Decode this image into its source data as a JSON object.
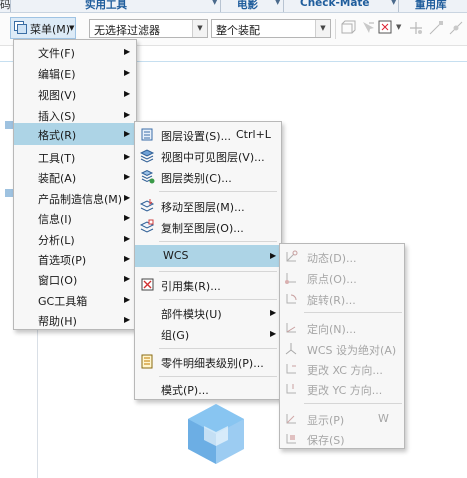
{
  "ribbon": {
    "tabs": [
      "实用工具",
      "电影",
      "Check-Mate",
      "重用库"
    ],
    "left_fragment": "码"
  },
  "toolbar": {
    "menu_label": "菜单(M)",
    "filter_value": "无选择过滤器",
    "assembly_value": "整个装配"
  },
  "main_menu": {
    "items": [
      {
        "label": "文件(F)"
      },
      {
        "label": "编辑(E)"
      },
      {
        "label": "视图(V)"
      },
      {
        "label": "插入(S)"
      },
      {
        "label": "格式(R)"
      },
      {
        "label": "工具(T)"
      },
      {
        "label": "装配(A)"
      },
      {
        "label": "产品制造信息(M)"
      },
      {
        "label": "信息(I)"
      },
      {
        "label": "分析(L)"
      },
      {
        "label": "首选项(P)"
      },
      {
        "label": "窗口(O)"
      },
      {
        "label": "GC工具箱"
      },
      {
        "label": "帮助(H)"
      }
    ]
  },
  "format_menu": {
    "items": [
      {
        "label": "图层设置(S)...",
        "shortcut": "Ctrl+L",
        "icon": "layer-settings-icon"
      },
      {
        "label": "视图中可见图层(V)...",
        "icon": "visible-layers-icon"
      },
      {
        "label": "图层类别(C)...",
        "icon": "layer-category-icon"
      },
      {
        "label": "移动至图层(M)...",
        "icon": "move-to-layer-icon"
      },
      {
        "label": "复制至图层(O)...",
        "icon": "copy-to-layer-icon"
      },
      {
        "label": "WCS"
      },
      {
        "label": "引用集(R)...",
        "icon": "reference-set-icon"
      },
      {
        "label": "部件模块(U)"
      },
      {
        "label": "组(G)"
      },
      {
        "label": "零件明细表级别(P)...",
        "icon": "parts-list-level-icon"
      },
      {
        "label": "模式(P)..."
      }
    ]
  },
  "wcs_menu": {
    "items": [
      {
        "label": "动态(D)...",
        "icon": "dynamic-wcs-icon"
      },
      {
        "label": "原点(O)...",
        "icon": "origin-icon"
      },
      {
        "label": "旋转(R)...",
        "icon": "rotate-icon"
      },
      {
        "label": "定向(N)...",
        "icon": "orient-icon"
      },
      {
        "label": "WCS 设为绝对(A)",
        "icon": "wcs-absolute-icon"
      },
      {
        "label": "更改 XC 方向...",
        "icon": "change-xc-icon"
      },
      {
        "label": "更改 YC 方向...",
        "icon": "change-yc-icon"
      },
      {
        "label": "显示(P)",
        "shortcut": "W",
        "icon": "display-wcs-icon"
      },
      {
        "label": "保存(S)",
        "icon": "save-wcs-icon"
      }
    ]
  },
  "colors": {
    "highlight": "#add4e6",
    "menu_bg": "#f7f7f7",
    "tab_text": "#1f5d9c",
    "disabled": "#a6a6a6"
  }
}
